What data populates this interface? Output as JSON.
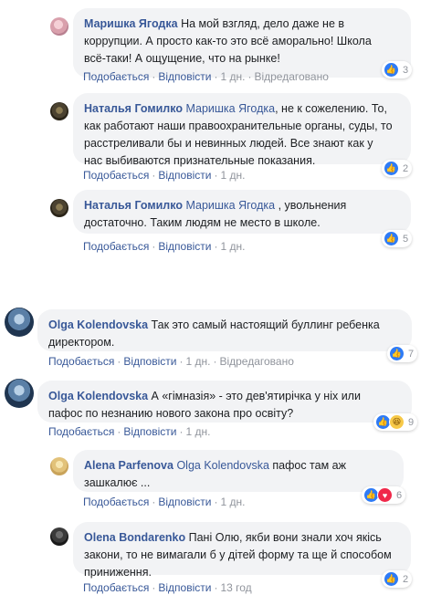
{
  "actions": {
    "like_ru": "Подобається",
    "reply": "Відповісти",
    "edited": "Відредаговано"
  },
  "comments": [
    {
      "author": "Маришка Ягодка",
      "lines": [
        "На мой взгляд, дело даже не в",
        "коррупции. А просто как-то это всё аморально! Школа",
        "всё-таки! А ощущение, что на рынке!"
      ],
      "time": "1 дн.",
      "reactions": {
        "count": "3",
        "icons": [
          "like-icon"
        ]
      }
    },
    {
      "author": "Наталья Гомилко",
      "mention": "Маришка Ягодка",
      "lines": [
        ", не к сожелению. То,",
        "как работают наши правоохранительные органы, суды, то",
        "расстреливали бы и невинных людей. Все знают как у",
        "нас выбиваются признательные показания."
      ],
      "time": "1 дн.",
      "reactions": {
        "count": "2",
        "icons": [
          "like-icon"
        ]
      }
    },
    {
      "author": "Наталья Гомилко",
      "mention": "Маришка Ягодка",
      "lines": [
        " , увольнения",
        "достаточно. Таким людям не место в школе."
      ],
      "time": "1 дн.",
      "reactions": {
        "count": "5",
        "icons": [
          "like-icon"
        ]
      }
    },
    {
      "author": "Olga Kolendovska",
      "lines": [
        "Так это самый настоящий буллинг ребенка",
        "директором."
      ],
      "time": "1 дн.",
      "reactions": {
        "count": "7",
        "icons": [
          "like-icon"
        ]
      }
    },
    {
      "author": "Olga Kolendovska",
      "lines": [
        "А «гімназія» - это дев'ятирічка у ніх или",
        "пафос по незнанию нового закона про освіту?"
      ],
      "time": "1 дн.",
      "reactions": {
        "count": "9",
        "icons": [
          "like-icon",
          "haha-icon"
        ]
      }
    },
    {
      "author": "Alena Parfenova",
      "mention": "Olga Kolendovska",
      "lines": [
        " пафос там аж",
        "зашкалює ..."
      ],
      "time": "1 дн.",
      "reactions": {
        "count": "6",
        "icons": [
          "like-icon",
          "love-icon"
        ]
      }
    },
    {
      "author": "Olena Bondarenko",
      "lines": [
        "Пані Олю, якби вони знали хоч якісь",
        "закони, то не вимагали б у дітей форму та ще й способом",
        "приниження."
      ],
      "time": "13 год",
      "reactions": {
        "count": "2",
        "icons": [
          "like-icon"
        ]
      }
    }
  ]
}
